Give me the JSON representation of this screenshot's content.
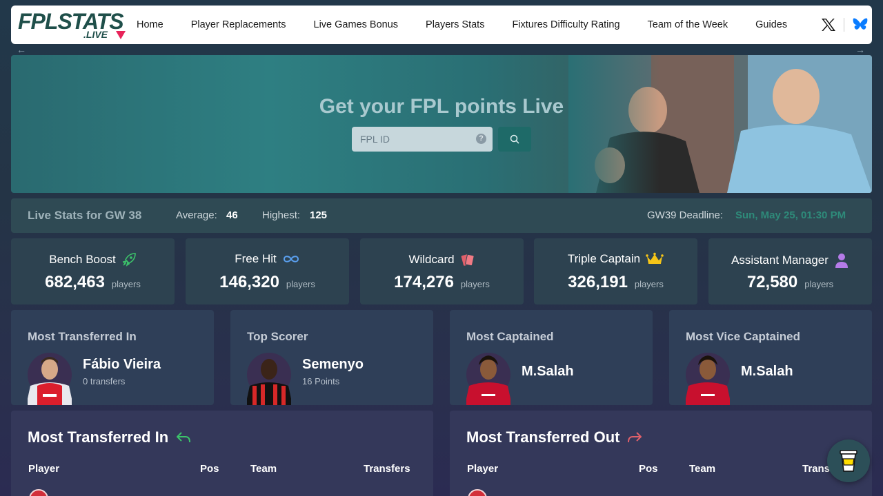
{
  "nav": {
    "logo_main": "FPLSTATS",
    "logo_sub": ".LIVE",
    "links": [
      "Home",
      "Player Replacements",
      "Live Games Bonus",
      "Players Stats",
      "Fixtures Difficulty Rating",
      "Team of the Week",
      "Guides"
    ],
    "social_icons": [
      "x-icon",
      "bluesky-icon"
    ]
  },
  "hero": {
    "title": "Get your FPL points Live",
    "input_placeholder": "FPL ID",
    "help_glyph": "?"
  },
  "statbar": {
    "title": "Live Stats for GW 38",
    "average_label": "Average:",
    "average_value": "46",
    "highest_label": "Highest:",
    "highest_value": "125",
    "deadline_label": "GW39 Deadline:",
    "deadline_value": "Sun, May 25, 01:30 PM"
  },
  "chips": [
    {
      "title": "Bench Boost",
      "icon": "rocket-icon",
      "count": "682,463",
      "unit": "players"
    },
    {
      "title": "Free Hit",
      "icon": "infinity-icon",
      "count": "146,320",
      "unit": "players"
    },
    {
      "title": "Wildcard",
      "icon": "cards-icon",
      "count": "174,276",
      "unit": "players"
    },
    {
      "title": "Triple Captain",
      "icon": "crown-icon",
      "count": "326,191",
      "unit": "players"
    },
    {
      "title": "Assistant Manager",
      "icon": "person-icon",
      "count": "72,580",
      "unit": "players"
    }
  ],
  "highlights": [
    {
      "title": "Most Transferred In",
      "name": "Fábio Vieira",
      "sub": "0 transfers",
      "kit": "arsenal"
    },
    {
      "title": "Top Scorer",
      "name": "Semenyo",
      "sub": "16 Points",
      "kit": "bournemouth"
    },
    {
      "title": "Most Captained",
      "name": "M.Salah",
      "sub": "",
      "kit": "liverpool"
    },
    {
      "title": "Most Vice Captained",
      "name": "M.Salah",
      "sub": "",
      "kit": "liverpool"
    }
  ],
  "panels": [
    {
      "title": "Most Transferred In",
      "icon": "transfer-in-icon",
      "cols": [
        "Player",
        "Pos",
        "Team",
        "Transfers"
      ]
    },
    {
      "title": "Most Transferred Out",
      "icon": "transfer-out-icon",
      "cols": [
        "Player",
        "Pos",
        "Team",
        "Transfers"
      ]
    }
  ],
  "colors": {
    "accent_teal": "#1e6a68",
    "deadline": "#2e8b7a",
    "transfer_in": "#3cc36a",
    "transfer_out": "#e0606a"
  }
}
